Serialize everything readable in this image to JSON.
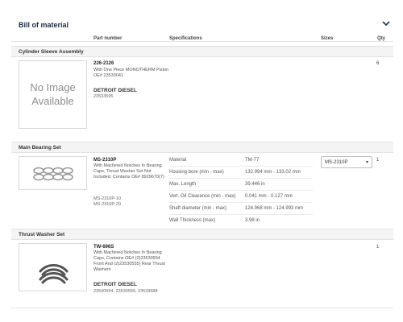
{
  "header": {
    "title": "Bill of material",
    "collapse_icon": "chevron-down-icon"
  },
  "columns": {
    "part_number": "Part number",
    "specifications": "Specifications",
    "sizes": "Sizes",
    "qty": "Qty"
  },
  "sections": [
    {
      "title": "Cylinder Sleeve Assembly",
      "image_placeholder": [
        "No Image",
        "Available"
      ],
      "part_number": "226-2126",
      "description": [
        "With One Piece MONOTHERM Piston",
        "OE# 23533041"
      ],
      "brand": "DETROIT DIESEL",
      "brand_numbers": "23533595",
      "qty": "6"
    },
    {
      "title": "Main Bearing Set",
      "part_number": "MS-2310P",
      "description": [
        "With Machined Notches In Bearing",
        "Caps, Thrust Washer Set Not",
        "Included, Contains OE# 8929670(7)"
      ],
      "variants": [
        "MS-2310P-10",
        "MS-2310P-20"
      ],
      "specs": [
        {
          "label": "Material",
          "value": "TM-77"
        },
        {
          "label": "Housing bore (min - max)",
          "value": "132.994 mm - 133.02 mm"
        },
        {
          "label": "Max. Length",
          "value": "39.446 in"
        },
        {
          "label": "Vert. Oil Clearance (min - max)",
          "value": "0.041 mm - 0.127 mm"
        },
        {
          "label": "Shaft diameter (min - max)",
          "value": "124.968 mm - 124.993 mm"
        },
        {
          "label": "Wall Thickness (max)",
          "value": "3.98 in"
        }
      ],
      "size_select": "MS-2310P",
      "qty": "1"
    },
    {
      "title": "Thrust Washer Set",
      "part_number": "TW-696S",
      "description": [
        "With Machined Notches In Bearing",
        "Caps, Contains OE# (2)23530554",
        "Front And (2)23530555) Rear Thrust",
        "Washers"
      ],
      "brand": "DETROIT DIESEL",
      "brand_numbers": "23530554, 23530555, 23533688",
      "qty": "1"
    }
  ]
}
